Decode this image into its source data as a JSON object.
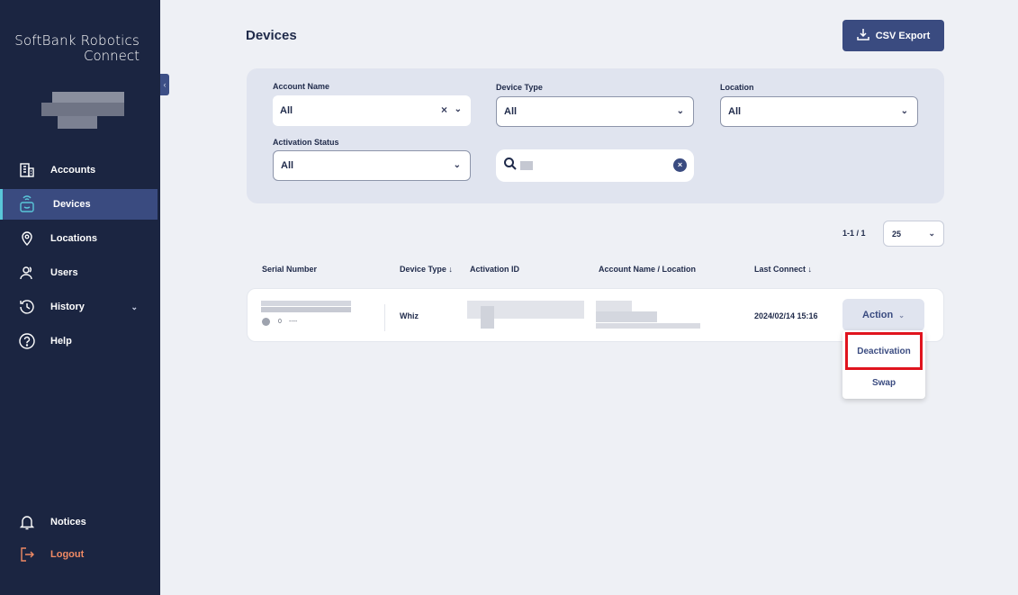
{
  "brand": {
    "line1": "SoftBank Robotics",
    "line2": "Connect"
  },
  "sidebar": {
    "items": [
      {
        "label": "Accounts"
      },
      {
        "label": "Devices"
      },
      {
        "label": "Locations"
      },
      {
        "label": "Users"
      },
      {
        "label": "History"
      },
      {
        "label": "Help"
      }
    ],
    "bottom": [
      {
        "label": "Notices"
      },
      {
        "label": "Logout"
      }
    ]
  },
  "header": {
    "title": "Devices",
    "export_label": "CSV Export"
  },
  "filters": {
    "account_name": {
      "label": "Account Name",
      "value": "All"
    },
    "device_type": {
      "label": "Device Type",
      "value": "All"
    },
    "location": {
      "label": "Location",
      "value": "All"
    },
    "activation_status": {
      "label": "Activation Status",
      "value": "All"
    }
  },
  "pagination": {
    "range": "1-1 / 1",
    "per_page": "25"
  },
  "table": {
    "headers": {
      "serial": "Serial Number",
      "device_type": "Device Type ↓",
      "activation_id": "Activation ID",
      "account_location": "Account Name / Location",
      "last_connect": "Last Connect ↓"
    },
    "rows": [
      {
        "status_count": "0",
        "status_text": "----",
        "device_type": "Whiz",
        "last_connect": "2024/02/14 15:16"
      }
    ]
  },
  "action": {
    "label": "Action",
    "menu": [
      {
        "label": "Deactivation"
      },
      {
        "label": "Swap"
      }
    ]
  },
  "colors": {
    "sidebar_bg": "#1b2541",
    "accent": "#3a4b80",
    "highlight": "#e0141e",
    "logout": "#f08a64"
  }
}
